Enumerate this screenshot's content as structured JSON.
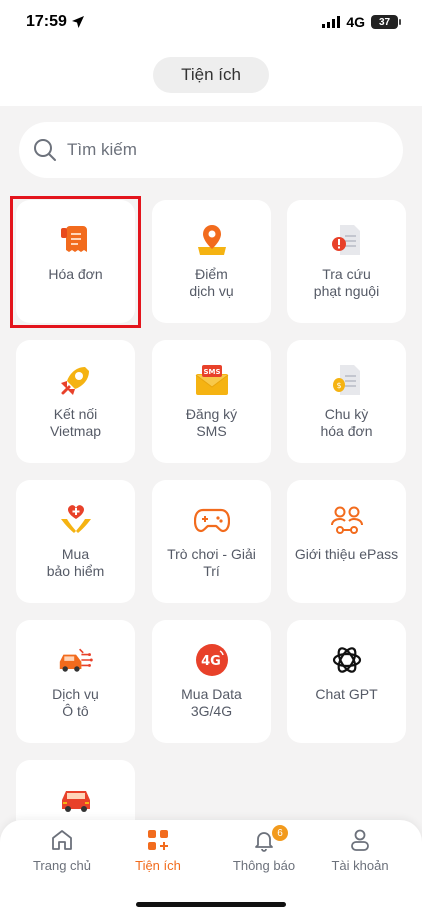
{
  "status_bar": {
    "time": "17:59",
    "network": "4G",
    "battery": "37"
  },
  "header": {
    "title": "Tiện ích"
  },
  "search": {
    "placeholder": "Tìm kiếm"
  },
  "tiles": [
    {
      "label": "Hóa đơn",
      "icon": "receipt-icon"
    },
    {
      "label": "Điểm\ndịch vụ",
      "icon": "map-pin-icon"
    },
    {
      "label": "Tra cứu\nphạt nguội",
      "icon": "document-alert-icon"
    },
    {
      "label": "Kết nối\nVietmap",
      "icon": "rocket-link-icon"
    },
    {
      "label": "Đăng ký\nSMS",
      "icon": "sms-envelope-icon"
    },
    {
      "label": "Chu kỳ\nhóa đơn",
      "icon": "document-coin-icon"
    },
    {
      "label": "Mua\nbảo hiểm",
      "icon": "hands-heart-icon"
    },
    {
      "label": "Trò chơi - Giải\nTrí",
      "icon": "gamepad-icon"
    },
    {
      "label": "Giới thiệu ePass",
      "icon": "users-share-icon"
    },
    {
      "label": "Dịch vụ\nÔ tô",
      "icon": "car-circuit-icon"
    },
    {
      "label": "Mua Data\n3G/4G",
      "icon": "4g-icon"
    },
    {
      "label": "Chat GPT",
      "icon": "openai-icon"
    },
    {
      "label": "",
      "icon": "car-icon"
    }
  ],
  "tabbar": {
    "items": [
      {
        "label": "Trang chủ",
        "icon": "home-icon"
      },
      {
        "label": "Tiện ích",
        "icon": "grid-plus-icon"
      },
      {
        "label": "Thông báo",
        "icon": "bell-icon",
        "badge": "6"
      },
      {
        "label": "Tài khoản",
        "icon": "user-icon"
      }
    ]
  },
  "colors": {
    "accent": "#f26b1d",
    "highlight": "#e3141c",
    "background": "#f4f3f3"
  }
}
